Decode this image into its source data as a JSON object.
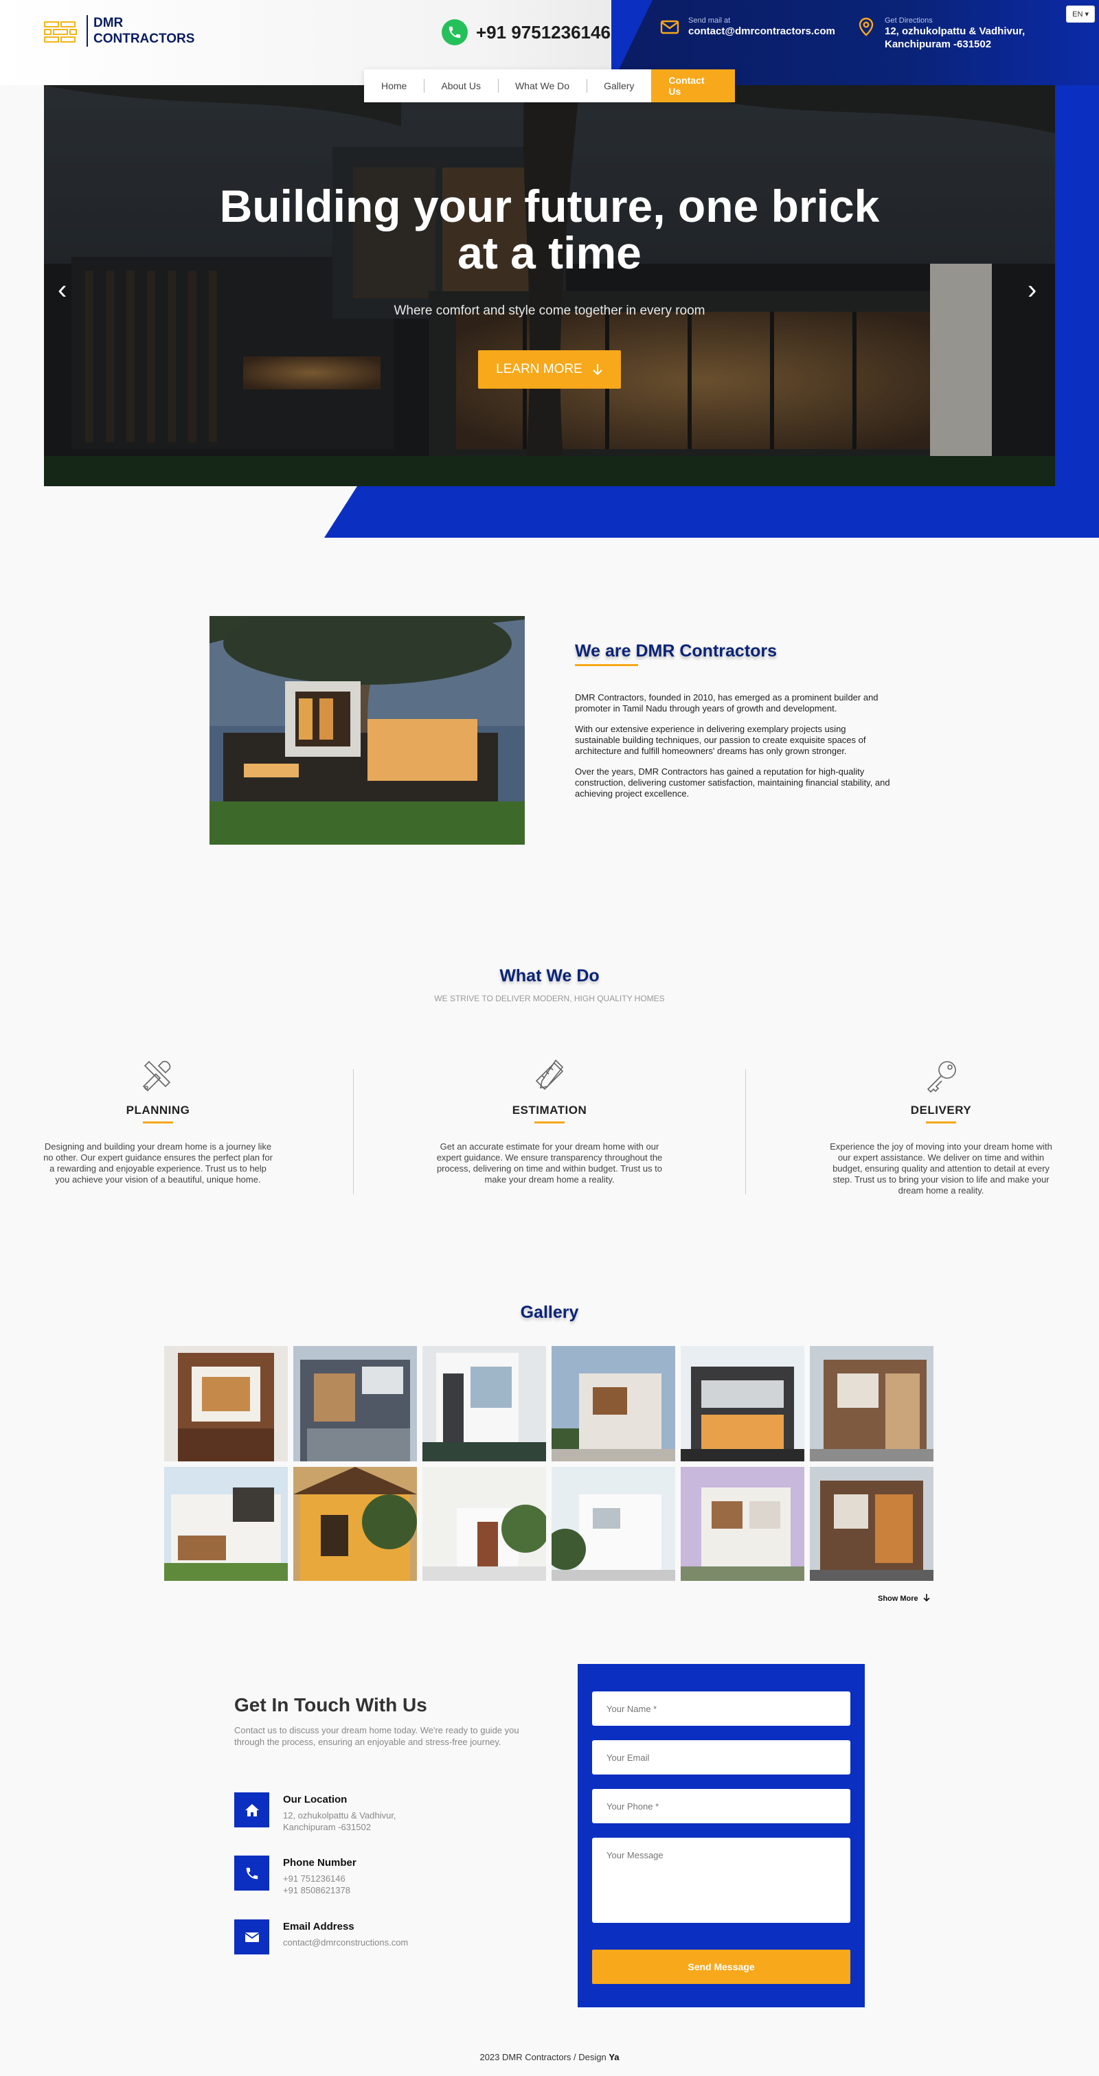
{
  "header": {
    "logo_line1": "DMR",
    "logo_line2": "CONTRACTORS",
    "phone": "+91 9751236146",
    "mail_label": "Send mail at",
    "mail_value": "contact@dmrcontractors.com",
    "dir_label": "Get Directions",
    "dir_line1": "12, ozhukolpattu & Vadhivur,",
    "dir_line2": "Kanchipuram -631502",
    "lang": "EN ▾"
  },
  "nav": {
    "items": [
      "Home",
      "About Us",
      "What We Do",
      "Gallery"
    ],
    "cta": "Contact Us"
  },
  "hero": {
    "title_line1": "Building your future, one brick",
    "title_line2": "at a time",
    "subtitle": "Where comfort and style come together in every room",
    "button": "LEARN MORE",
    "prev": "‹",
    "next": "›",
    "slide_count": 4,
    "active_slide": 1
  },
  "about": {
    "title": "We are DMR Contractors",
    "p1": "DMR Contractors, founded in 2010, has emerged as a prominent builder and promoter in Tamil Nadu through years of growth and development.",
    "p2": "With our extensive experience in delivering exemplary projects using sustainable building techniques, our passion to create exquisite spaces of architecture and fulfill homeowners' dreams has only grown stronger.",
    "p3": "Over the years, DMR Contractors has gained a reputation for high-quality construction, delivering customer satisfaction, maintaining financial stability, and achieving project excellence."
  },
  "services": {
    "title": "What We Do",
    "subtitle": "WE STRIVE TO DELIVER MODERN, HIGH QUALITY HOMES",
    "items": [
      {
        "icon": "tools-icon",
        "name": "PLANNING",
        "text": "Designing and building your dream home is a journey like no other. Our expert guidance ensures the perfect plan for a rewarding and enjoyable experience. Trust us to help you achieve your vision of a beautiful, unique home."
      },
      {
        "icon": "ruler-pencil-icon",
        "name": "ESTIMATION",
        "text": "Get an accurate estimate for your dream home with our expert guidance. We ensure transparency throughout the process, delivering on time and within budget. Trust us to make your dream home a reality."
      },
      {
        "icon": "key-icon",
        "name": "DELIVERY",
        "text": "Experience the joy of moving into your dream home with our expert assistance. We deliver on time and within budget, ensuring quality and attention to detail at every step. Trust us to bring your vision to life and make your dream home a reality."
      }
    ]
  },
  "gallery": {
    "title": "Gallery",
    "show_more": "Show More"
  },
  "contact": {
    "title": "Get In Touch With Us",
    "desc": "Contact us to discuss your dream home today. We're ready to guide you through the process, ensuring an enjoyable and stress-free journey.",
    "location_label": "Our Location",
    "location_line1": "12, ozhukolpattu & Vadhivur,",
    "location_line2": "Kanchipuram -631502",
    "phone_label": "Phone Number",
    "phone1": "+91 751236146",
    "phone2": "+91 8508621378",
    "email_label": "Email Address",
    "email": "contact@dmrconstructions.com",
    "form": {
      "name_placeholder": "Your Name *",
      "email_placeholder": "Your Email",
      "phone_placeholder": "Your Phone *",
      "message_placeholder": "Your Message",
      "send": "Send Message"
    }
  },
  "footer": {
    "text": "2023 DMR Contractors / Design ",
    "designer": "Ya"
  },
  "colors": {
    "brand_blue": "#0b2fc0",
    "navy": "#0a2377",
    "accent": "#f7a81b",
    "whatsapp": "#25c05a"
  }
}
